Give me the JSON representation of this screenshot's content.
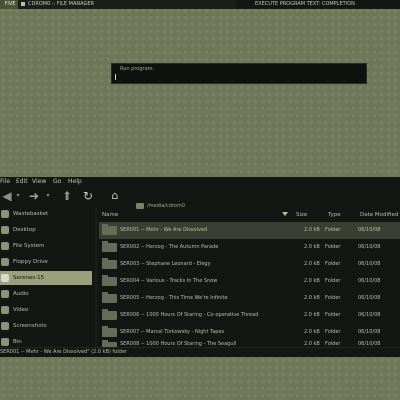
{
  "panel": {
    "workspace": "FIVE",
    "window_title": "CDROM0 :: FILE MANAGER",
    "status": "EXECUTE PROGRAM TEXT: COMPLETION"
  },
  "run_dialog": {
    "label": "Run program:",
    "value": ""
  },
  "file_manager": {
    "menu": [
      "File",
      "Edit",
      "View",
      "Go",
      "Help"
    ],
    "location": "/media/cdrom0",
    "sidebar": [
      {
        "label": "Wastebasket",
        "icon": "trash-icon"
      },
      {
        "label": "Desktop",
        "icon": "desktop-icon"
      },
      {
        "label": "File System",
        "icon": "harddisk-icon"
      },
      {
        "label": "Floppy Drive",
        "icon": "floppy-icon"
      },
      {
        "label": "Serenes-15",
        "icon": "cdrom-icon",
        "active": true
      },
      {
        "label": "Audio",
        "icon": "folder-icon"
      },
      {
        "label": "Video",
        "icon": "folder-icon"
      },
      {
        "label": "Screenshots",
        "icon": "folder-icon"
      },
      {
        "label": "Bin",
        "icon": "folder-icon"
      }
    ],
    "columns": {
      "name": "Name",
      "size": "Size",
      "type": "Type",
      "date": "Date Modified"
    },
    "rows": [
      {
        "name": "SER001 -- Mehr - We Are Dissolved",
        "size": "2.0 kB",
        "type": "Folder",
        "date": "06/10/08"
      },
      {
        "name": "SER002 -- Herzog - The Autumn Parade",
        "size": "2.0 kB",
        "type": "Folder",
        "date": "06/10/08"
      },
      {
        "name": "SER003 -- Stephane Leonard - Elegy",
        "size": "2.0 kB",
        "type": "Folder",
        "date": "06/10/08"
      },
      {
        "name": "SER004 -- Various - Tracks In The Snow",
        "size": "2.0 kB",
        "type": "Folder",
        "date": "06/10/08"
      },
      {
        "name": "SER005 -- Herzog - This Time We're Infinite",
        "size": "2.0 kB",
        "type": "Folder",
        "date": "06/10/08"
      },
      {
        "name": "SER006 -- 1000 Hours Of Staring - Co-operative Thread",
        "size": "2.0 kB",
        "type": "Folder",
        "date": "06/10/08"
      },
      {
        "name": "SER007 -- Marcel Türkowsky - Night Tapes",
        "size": "2.0 kB",
        "type": "Folder",
        "date": "06/10/08"
      },
      {
        "name": "SER008 -- 1000 Hours Of Staring - The Seagull",
        "size": "2.0 kB",
        "type": "Folder",
        "date": "06/10/08"
      }
    ],
    "status": "SER001 -- Mehr - We Are Dissolved\" (2.0 kB) folder"
  }
}
